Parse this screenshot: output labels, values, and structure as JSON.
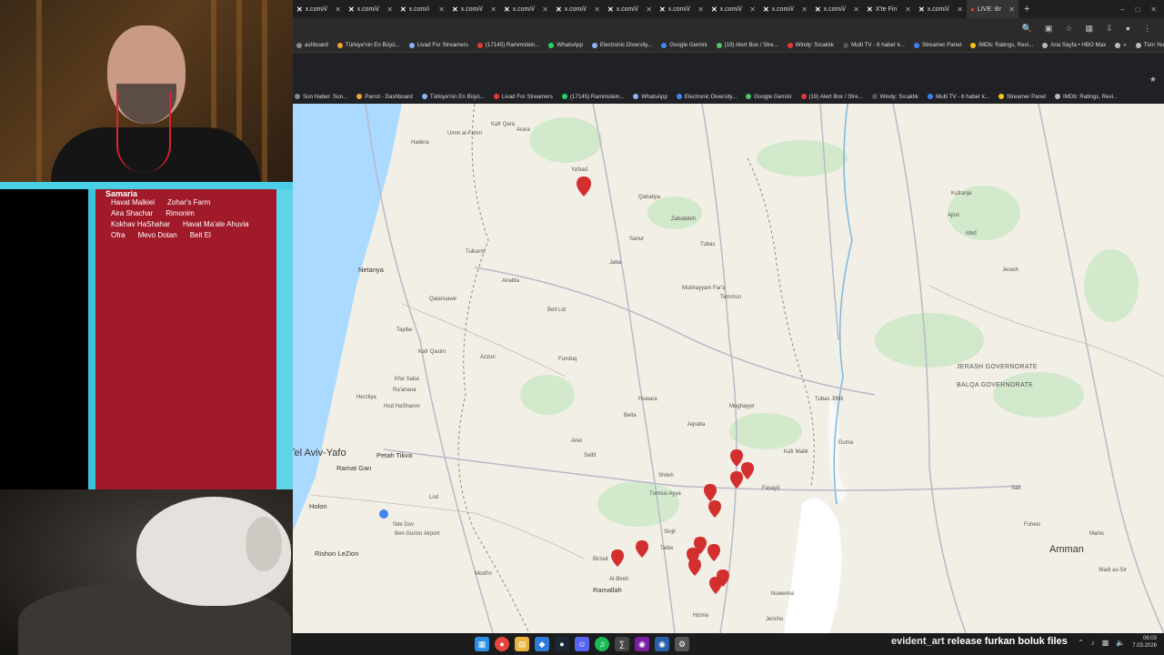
{
  "browser": {
    "tabs": [
      {
        "label": "x.com/i/"
      },
      {
        "label": "x.com/i/"
      },
      {
        "label": "x.com/i"
      },
      {
        "label": "x.com/i/"
      },
      {
        "label": "x.com/i/"
      },
      {
        "label": "x.com/i/"
      },
      {
        "label": "x.com/i/"
      },
      {
        "label": "x.com/i/"
      },
      {
        "label": "x.com/i/"
      },
      {
        "label": "x.com/i/"
      },
      {
        "label": "x.com/i/"
      },
      {
        "label": "X'te Fin"
      },
      {
        "label": "x.com/i/"
      },
      {
        "label": "LIVE: Br"
      }
    ],
    "new_tab": "+",
    "bookmarks_top": [
      "ashboard",
      "Türkiye'nin En Büyü...",
      "Livad For Streamers",
      "(17145) Rammstein...",
      "WhatsApp",
      "Electronic Diversity...",
      "Google Gemini",
      "(19) Alert Box / Stre...",
      "Windy: Sıcaklık",
      "Multi TV - 6 haber k...",
      "Streamer Panel",
      "IMDb: Ratings, Revi...",
      "Ana Sayfa • HBO Max",
      "»",
      "Tüm Yer İşaretleri"
    ],
    "bookmarks_page": [
      "Son Haber: Son...",
      "Parrot - Dashboard",
      "Türkiye'nin En Büyü...",
      "Livad For Streamers",
      "(17145) Rammstein...",
      "WhatsApp",
      "Electronic Diversity...",
      "Google Gemini",
      "(19) Alert Box / Stre...",
      "Windy: Sıcaklık",
      "Multi TV - 6 haber k...",
      "Streamer Panel",
      "IMDb: Ratings, Revi..."
    ]
  },
  "panel": {
    "title": "Samaria",
    "rows": [
      [
        "Havat Malkiel",
        "Zohar's Farm"
      ],
      [
        "Aira Shachar",
        "Rimonim"
      ],
      [
        "Kokhav HaShahar",
        "Havat Ma'ale Ahuvia"
      ],
      [
        "Ofra",
        "Mevo Dotan",
        "Beit El"
      ]
    ]
  },
  "map": {
    "labels_big": [
      "Tel Aviv-Yafo",
      "Amman"
    ],
    "labels_mid": [
      "Netanya",
      "Petah Tikva",
      "Ramat Gan",
      "Holon",
      "Rishon LeZion",
      "Ramallah"
    ],
    "labels_gov": [
      "JERASH GOVERNORATE",
      "BALQA GOVERNORATE"
    ],
    "labels_small": [
      "Kafr Qara",
      "Arara",
      "Umm al-Fahm",
      "Hadera",
      "Ya'bad",
      "Qabatiya",
      "Zababdeh",
      "Tubas",
      "Tammun",
      "Mukhayyam Far'a",
      "Sanur",
      "Jaba",
      "Tulkarm",
      "Anabta",
      "Tayibe",
      "Qalansawe",
      "Kafr Qasim",
      "Kfar Saba",
      "Ra'anana",
      "Herzliya",
      "Hod HaSharon",
      "Ariel",
      "Salfit",
      "Aqraba",
      "Huwara",
      "Beita",
      "Turmus Ayya",
      "Shiloh",
      "Sinjil",
      "Taibe",
      "Birzeit",
      "Al-Bireh",
      "Modi'in",
      "Jericho",
      "Nuweima",
      "Ajlun",
      "Kufranja",
      "Irbid",
      "Jerash",
      "Salt",
      "Fuheis",
      "Mahis",
      "Wadi as-Sir",
      "Beit Lid",
      "Funduq",
      "Azzun",
      "Tubas Jiftlik",
      "Fasayil",
      "Duma",
      "Mughayyir",
      "Kafr Malik",
      "Hizma",
      "Sde Dov",
      "Lod",
      "Ben Gurion Airport"
    ],
    "pins": [
      "pin"
    ]
  },
  "taskbar": {
    "ticker_user": "evident_art",
    "ticker_text": "release furkan boluk files",
    "time": "06:03",
    "date": "7.03.2026"
  }
}
